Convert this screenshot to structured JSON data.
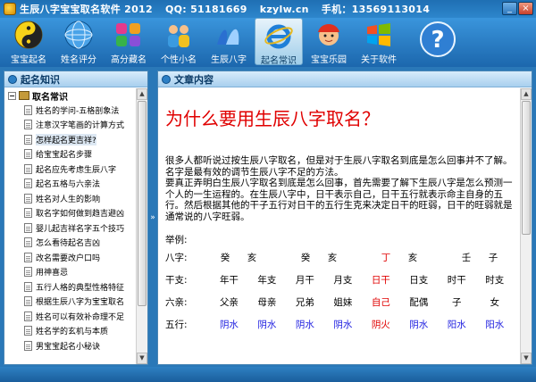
{
  "window": {
    "title": "生辰八字宝宝取名软件 2012",
    "qq": "QQ: 51181669",
    "site": "kzylw.cn",
    "phone": "手机：13569113014"
  },
  "toolbar": {
    "items": [
      {
        "label": "宝宝起名",
        "icon": "yin-yang-icon"
      },
      {
        "label": "姓名评分",
        "icon": "globe-icon"
      },
      {
        "label": "高分藏名",
        "icon": "gems-icon"
      },
      {
        "label": "个性小名",
        "icon": "people-icon"
      },
      {
        "label": "生辰八字",
        "icon": "ribbon-icon"
      },
      {
        "label": "起名常识",
        "icon": "ie-icon",
        "active": true
      },
      {
        "label": "宝宝乐园",
        "icon": "kid-icon"
      },
      {
        "label": "关于软件",
        "icon": "windows-icon"
      },
      {
        "label": "",
        "icon": "help-icon"
      }
    ]
  },
  "left": {
    "header": "起名知识",
    "root": "取名常识",
    "items": [
      "姓名的学问-五格剖象法",
      "注意汉字笔画的计算方式",
      "怎样起名更吉祥?",
      "给宝宝起名步骤",
      "起名应先考虑生辰八字",
      "起名五格与六亲法",
      "姓名对人生的影响",
      "取名字如何做到趋吉避凶",
      "婴儿起吉祥名字五个技巧",
      "怎么看待起名吉凶",
      "改名需要改户口吗",
      "用神喜忌",
      "五行人格的典型性格特征",
      "根据生辰八字为宝宝取名",
      "姓名可以有效补命理不足",
      "姓名学的玄机与本质",
      "男宝宝起名小秘诀"
    ],
    "selected_index": 2
  },
  "right": {
    "header": "文章内容",
    "title": "为什么要用生辰八字取名？",
    "para1": "很多人都听说过按生辰八字取名，但是对于生辰八字取名到底是怎么回事并不了解。名字是最有效的调节生辰八字不足的方法。",
    "para2": "要真正弄明白生辰八字取名到底是怎么回事，首先需要了解下生辰八字是怎么预测一个人的一生运程的。在生辰八字中，日干表示自己，日干五行就表示命主自身的五行。然后根据其他的干子五行对日干的五行生克来决定日干的旺弱，日干的旺弱就是通常说的八字旺弱。",
    "example": "举例:",
    "rows": [
      {
        "label": "八字:",
        "cells": [
          "癸",
          "亥",
          "",
          "癸",
          "亥",
          "",
          "丁",
          "亥",
          "",
          "壬",
          "子"
        ]
      },
      {
        "label": "干支:",
        "cells": [
          "年干",
          "年支",
          "月干",
          "月支",
          "日干",
          "日支",
          "时干",
          "时支"
        ]
      },
      {
        "label": "六亲:",
        "cells": [
          "父亲",
          "母亲",
          "兄弟",
          "姐妹",
          "自己",
          "配偶",
          "子",
          "女"
        ]
      },
      {
        "label": "五行:",
        "cells": [
          "阴水",
          "阴水",
          "阴水",
          "阴水",
          "阴火",
          "阴水",
          "阳水",
          "阳水"
        ]
      }
    ]
  },
  "colors": {
    "accent": "#e00000",
    "blue": "#2020e0",
    "chrome": "#2a78b8"
  }
}
